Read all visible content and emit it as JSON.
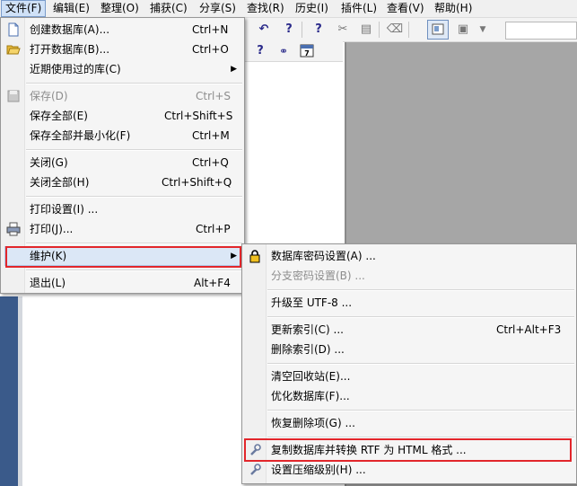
{
  "menubar": {
    "items": [
      {
        "label": "文件(F)"
      },
      {
        "label": "编辑(E)"
      },
      {
        "label": "整理(O)"
      },
      {
        "label": "捕获(C)"
      },
      {
        "label": "分享(S)"
      },
      {
        "label": "查找(R)"
      },
      {
        "label": "历史(I)"
      },
      {
        "label": "插件(L)"
      },
      {
        "label": "查看(V)"
      },
      {
        "label": "帮助(H)"
      }
    ]
  },
  "file_menu": {
    "items": [
      {
        "label": "创建数据库(A)...",
        "shortcut": "Ctrl+N",
        "icon": "new-document-icon"
      },
      {
        "label": "打开数据库(B)...",
        "shortcut": "Ctrl+O",
        "icon": "open-folder-icon"
      },
      {
        "label": "近期使用过的库(C)",
        "shortcut": ""
      },
      {
        "label": "保存(D)",
        "shortcut": "Ctrl+S",
        "icon": "save-icon"
      },
      {
        "label": "保存全部(E)",
        "shortcut": "Ctrl+Shift+S"
      },
      {
        "label": "保存全部并最小化(F)",
        "shortcut": "Ctrl+M"
      },
      {
        "label": "关闭(G)",
        "shortcut": "Ctrl+Q"
      },
      {
        "label": "关闭全部(H)",
        "shortcut": "Ctrl+Shift+Q"
      },
      {
        "label": "打印设置(I) ...",
        "shortcut": ""
      },
      {
        "label": "打印(J)...",
        "shortcut": "Ctrl+P",
        "icon": "printer-icon"
      },
      {
        "label": "维护(K)",
        "shortcut": ""
      },
      {
        "label": "退出(L)",
        "shortcut": "Alt+F4"
      }
    ]
  },
  "maintenance_menu": {
    "items": [
      {
        "label": "数据库密码设置(A) ...",
        "shortcut": "",
        "icon": "lock-icon"
      },
      {
        "label": "分支密码设置(B) ...",
        "shortcut": ""
      },
      {
        "label": "升级至 UTF-8 ...",
        "shortcut": ""
      },
      {
        "label": "更新索引(C) ...",
        "shortcut": "Ctrl+Alt+F3"
      },
      {
        "label": "删除索引(D) ...",
        "shortcut": ""
      },
      {
        "label": "清空回收站(E)...",
        "shortcut": ""
      },
      {
        "label": "优化数据库(F)...",
        "shortcut": ""
      },
      {
        "label": "恢复删除项(G) ...",
        "shortcut": ""
      },
      {
        "label": "复制数据库并转换 RTF 为 HTML 格式 ...",
        "shortcut": "",
        "icon": "wrench-icon"
      },
      {
        "label": "设置压缩级别(H) ...",
        "shortcut": "",
        "icon": "wrench-icon"
      }
    ]
  },
  "toolbar": {
    "icons": [
      "undo-icon",
      "help-icon",
      "help-icon",
      "scissors-icon",
      "paste-icon",
      "eraser-icon",
      "view-toggle-icon",
      "layout-icon",
      "dropdown-arrow-icon"
    ],
    "icons_row2": [
      "help-icon",
      "link-icon",
      "calendar-icon"
    ],
    "calendar_day": "7"
  },
  "colors": {
    "highlight": "#e2262b",
    "accent": "#3a5a8a"
  }
}
